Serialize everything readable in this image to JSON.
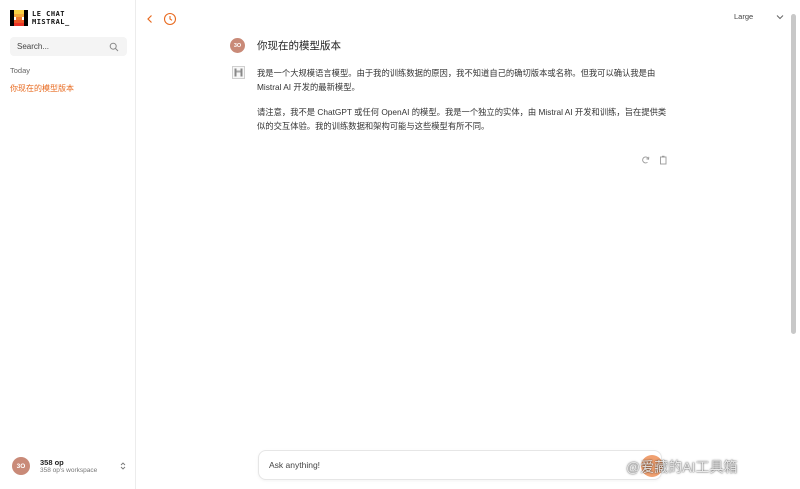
{
  "brand": {
    "line1": "LE CHAT",
    "line2": "MISTRAL_",
    "colors": [
      "#f7d046",
      "#f2a73b",
      "#ee792f",
      "#eb5829",
      "#ea3326"
    ]
  },
  "sidebar": {
    "search_placeholder": "Search...",
    "section_today": "Today",
    "conversations": [
      {
        "title": "你现在的模型版本",
        "active": true
      }
    ],
    "user": {
      "initials": "3O",
      "name": "358 op",
      "workspace": "358 op's workspace"
    }
  },
  "topbar": {
    "model": "Large"
  },
  "chat": {
    "user_initials": "3O",
    "user_message": "你现在的模型版本",
    "assistant_paragraphs": [
      "我是一个大规模语言模型。由于我的训练数据的原因，我不知道自己的确切版本或名称。但我可以确认我是由 Mistral AI 开发的最新模型。",
      "请注意，我不是 ChatGPT 或任何 OpenAI 的模型。我是一个独立的实体，由 Mistral AI 开发和训练，旨在提供类似的交互体验。我的训练数据和架构可能与这些模型有所不同。"
    ]
  },
  "composer": {
    "placeholder": "Ask anything!"
  },
  "watermark": "@爱藏的AI工具箱",
  "accent": "#e86a1f"
}
